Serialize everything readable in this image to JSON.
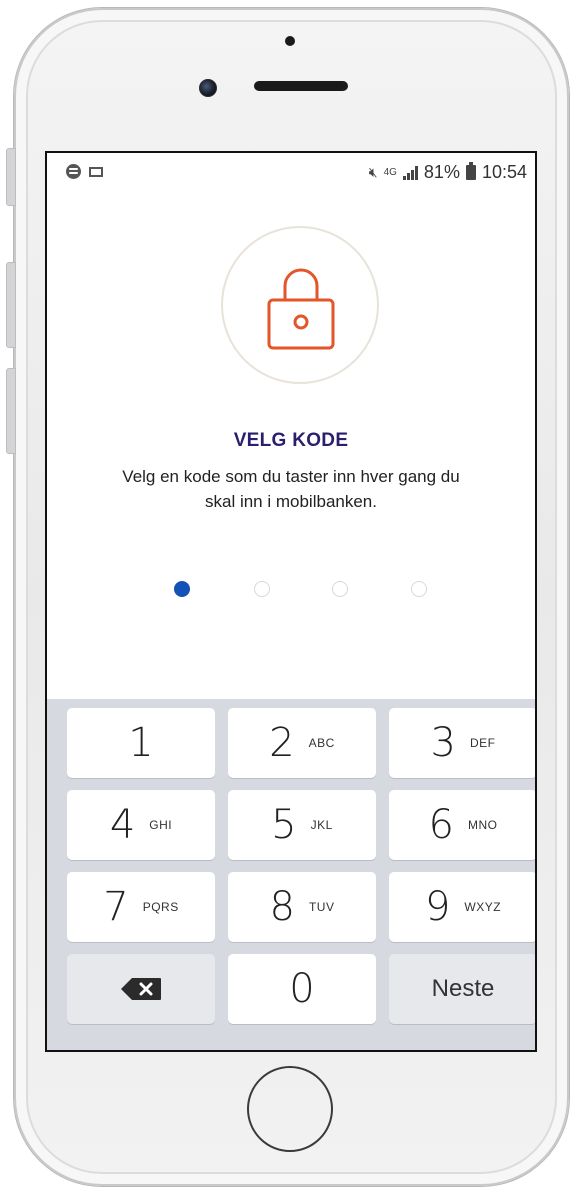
{
  "status_bar": {
    "battery": "81%",
    "time": "10:54",
    "network": "4G"
  },
  "screen": {
    "title": "VELG KODE",
    "subtitle": "Velg en kode som du taster inn hver gang du skal inn i mobilbanken.",
    "pin_length": 4,
    "pin_entered": 1
  },
  "colors": {
    "accent_lock": "#e2562a",
    "title": "#2a1f6e",
    "dot_filled": "#1353b8"
  },
  "keypad": {
    "keys": [
      {
        "digit": "1",
        "letters": ""
      },
      {
        "digit": "2",
        "letters": "ABC"
      },
      {
        "digit": "3",
        "letters": "DEF"
      },
      {
        "digit": "4",
        "letters": "GHI"
      },
      {
        "digit": "5",
        "letters": "JKL"
      },
      {
        "digit": "6",
        "letters": "MNO"
      },
      {
        "digit": "7",
        "letters": "PQRS"
      },
      {
        "digit": "8",
        "letters": "TUV"
      },
      {
        "digit": "9",
        "letters": "WXYZ"
      },
      {
        "digit": "0",
        "letters": ""
      }
    ],
    "next_label": "Neste",
    "backspace_icon": "backspace-icon"
  }
}
